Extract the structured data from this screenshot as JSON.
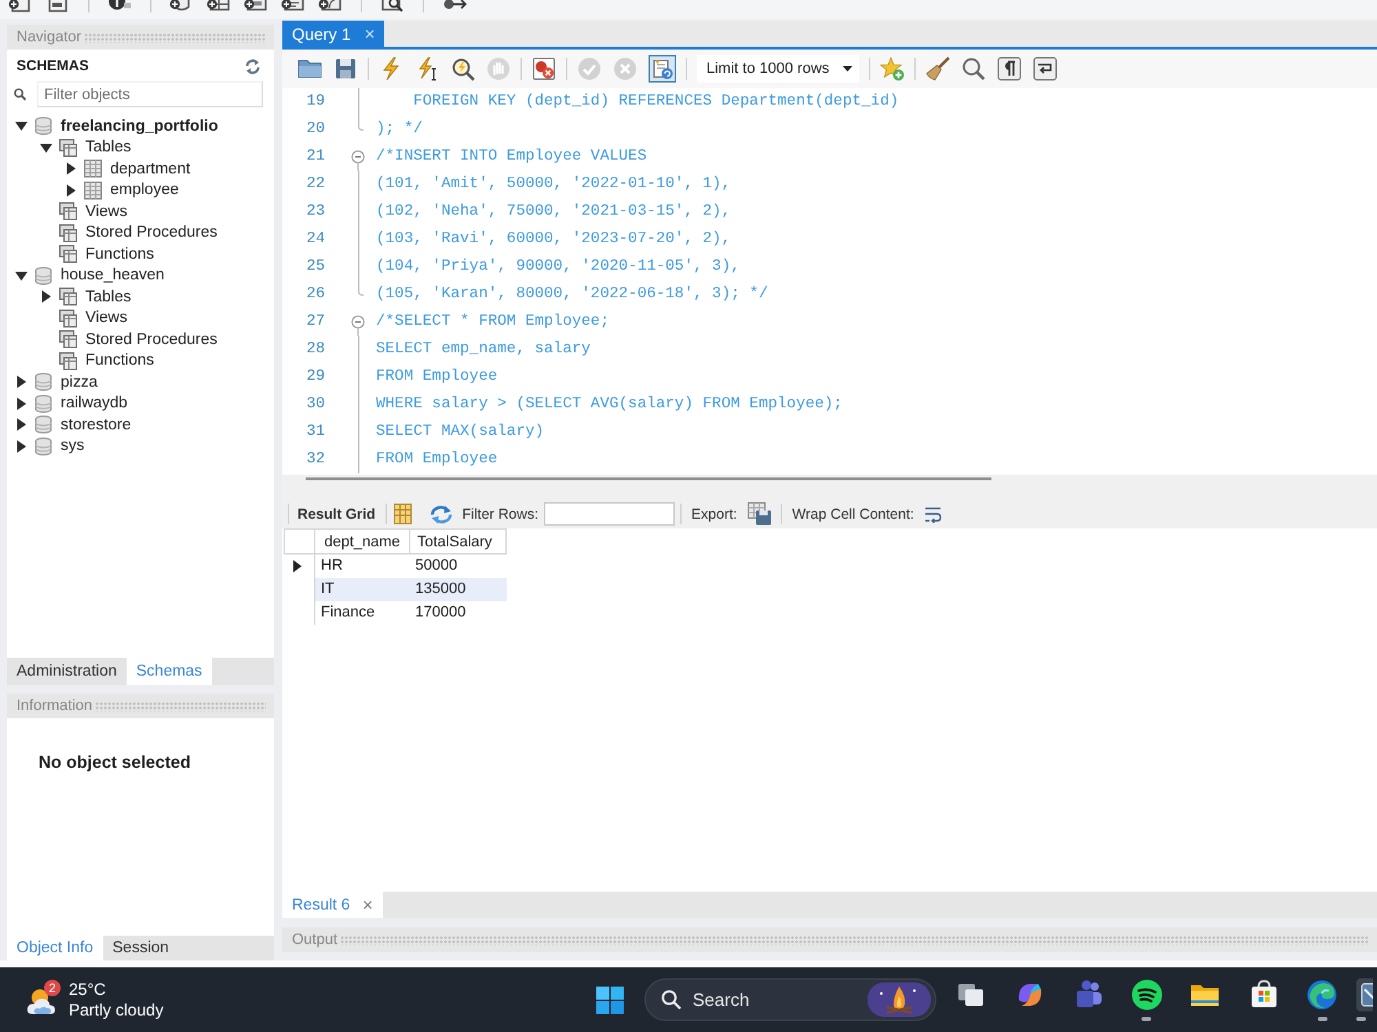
{
  "navigator": {
    "title": "Navigator",
    "heading": "SCHEMAS",
    "filter": {
      "placeholder": "Filter objects"
    },
    "schemas": [
      {
        "label": "freelancing_portfolio",
        "active": true,
        "expanded": true,
        "children": [
          {
            "label": "Tables",
            "expanded": true,
            "children": [
              {
                "label": "department",
                "expanded": false
              },
              {
                "label": "employee",
                "expanded": false
              }
            ]
          },
          {
            "label": "Views"
          },
          {
            "label": "Stored Procedures"
          },
          {
            "label": "Functions"
          }
        ]
      },
      {
        "label": "house_heaven",
        "active": false,
        "expanded": true,
        "children": [
          {
            "label": "Tables",
            "expanded": false
          },
          {
            "label": "Views"
          },
          {
            "label": "Stored Procedures"
          },
          {
            "label": "Functions"
          }
        ]
      },
      {
        "label": "pizza",
        "active": false,
        "expanded": false
      },
      {
        "label": "railwaydb",
        "active": false,
        "expanded": false
      },
      {
        "label": "storestore",
        "active": false,
        "expanded": false
      },
      {
        "label": "sys",
        "active": false,
        "expanded": false
      }
    ]
  },
  "navigator_tabs": [
    {
      "label": "Administration",
      "selected": false
    },
    {
      "label": "Schemas",
      "selected": true
    }
  ],
  "information": {
    "title": "Information",
    "message": "No object selected"
  },
  "info_tabs": [
    {
      "label": "Object Info",
      "selected": true
    },
    {
      "label": "Session",
      "selected": false
    }
  ],
  "query_tabs": [
    {
      "label": "Query 1",
      "close": "×",
      "selected": true
    }
  ],
  "query_toolbar": {
    "toggle_on": true,
    "commit_disabled": true,
    "limit": "Limit to 1000 rows"
  },
  "editor": {
    "lines": [
      {
        "number": "19",
        "text": "    FOREIGN KEY (dept_id) REFERENCES Department(dept_id)",
        "kind": "body"
      },
      {
        "number": "20",
        "text": "); */",
        "kind": "end"
      },
      {
        "number": "21",
        "text": "/*INSERT INTO Employee VALUES",
        "kind": "start"
      },
      {
        "number": "22",
        "text": "(101, 'Amit', 50000, '2022-01-10', 1),",
        "kind": "body"
      },
      {
        "number": "23",
        "text": "(102, 'Neha', 75000, '2021-03-15', 2),",
        "kind": "body"
      },
      {
        "number": "24",
        "text": "(103, 'Ravi', 60000, '2023-07-20', 2),",
        "kind": "body"
      },
      {
        "number": "25",
        "text": "(104, 'Priya', 90000, '2020-11-05', 3),",
        "kind": "body"
      },
      {
        "number": "26",
        "text": "(105, 'Karan', 80000, '2022-06-18', 3); */",
        "kind": "end"
      },
      {
        "number": "27",
        "text": "/*SELECT * FROM Employee;",
        "kind": "start"
      },
      {
        "number": "28",
        "text": "SELECT emp_name, salary",
        "kind": "body"
      },
      {
        "number": "29",
        "text": "FROM Employee",
        "kind": "body"
      },
      {
        "number": "30",
        "text": "WHERE salary > (SELECT AVG(salary) FROM Employee);",
        "kind": "body"
      },
      {
        "number": "31",
        "text": "SELECT MAX(salary)",
        "kind": "body"
      },
      {
        "number": "32",
        "text": "FROM Employee",
        "kind": "body"
      }
    ]
  },
  "result_toolbar": {
    "view": "Result Grid",
    "filter_label": "Filter Rows:",
    "export_label": "Export:",
    "wrap_label": "Wrap Cell Content:"
  },
  "result_grid": {
    "columns": [
      "dept_name",
      "TotalSalary"
    ],
    "rows": [
      {
        "cells": [
          "HR",
          "50000"
        ],
        "current": true,
        "selected": false
      },
      {
        "cells": [
          "IT",
          "135000"
        ],
        "current": false,
        "selected": true
      },
      {
        "cells": [
          "Finance",
          "170000"
        ],
        "current": false,
        "selected": false
      }
    ]
  },
  "result_tabs": [
    {
      "label": "Result 6",
      "close": "×",
      "selected": true
    }
  ],
  "output": {
    "title": "Output"
  },
  "taskbar": {
    "weather": {
      "badge": "2",
      "temperature": "25°C",
      "condition": "Partly cloudy"
    },
    "search": {
      "placeholder": "Search"
    },
    "apps": [
      {
        "kind": "overlapping_squares",
        "running": false,
        "active": false
      },
      {
        "kind": "swirl",
        "running": false,
        "active": false
      },
      {
        "kind": "people",
        "running": false,
        "active": false
      },
      {
        "kind": "sound_waves",
        "running": true,
        "active": false
      },
      {
        "kind": "folder",
        "running": false,
        "active": false
      },
      {
        "kind": "shopping_bag",
        "running": false,
        "active": false
      },
      {
        "kind": "wave",
        "running": true,
        "active": false
      },
      {
        "kind": "window",
        "running": true,
        "active": true
      }
    ]
  }
}
